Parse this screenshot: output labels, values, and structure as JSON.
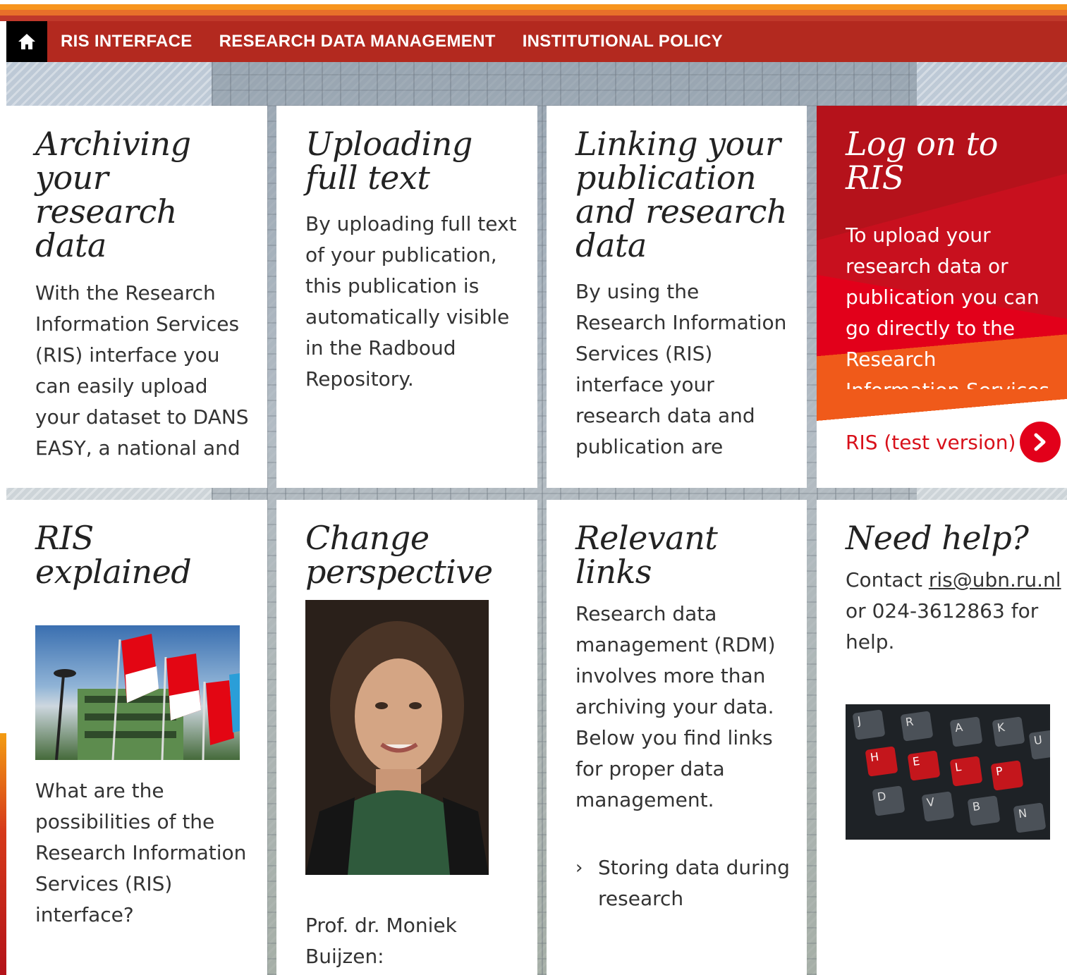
{
  "nav": {
    "home_label": "Home",
    "items": [
      {
        "label": "RIS INTERFACE"
      },
      {
        "label": "RESEARCH DATA MANAGEMENT"
      },
      {
        "label": "INSTITUTIONAL POLICY"
      }
    ]
  },
  "cards": {
    "archiving": {
      "title": "Archiving your research data",
      "body": "With the Research Information Services (RIS) interface you can easily upload your dataset to DANS EASY, a national and"
    },
    "uploading": {
      "title": "Uploading full text",
      "body": "By uploading full text of your publication, this publication is automatically visible in the Radboud Repository."
    },
    "linking": {
      "title": "Linking your publication and research data",
      "body": "By using the Research Information Services (RIS) interface your research data and publication are"
    },
    "login": {
      "title": "Log on to RIS",
      "body": "To upload your research data or publication you can go directly to the Research Information Services",
      "link_label": "RIS (test version)"
    },
    "ris_explained": {
      "title": "RIS explained",
      "image_alt": "Radboud University flags",
      "body": "What are the possibilities of the Research Information Services (RIS) interface?"
    },
    "change_perspective": {
      "title": "Change perspective",
      "image_alt": "Prof. dr. Moniek Buijzen portrait",
      "body": "Prof. dr. Moniek Buijzen:"
    },
    "relevant_links": {
      "title": "Relevant links",
      "body": "Research data management (RDM) involves more than archiving your data. Below you find links for proper data management.",
      "links": [
        {
          "label": "Storing data during research"
        }
      ]
    },
    "need_help": {
      "title": "Need help?",
      "contact_prefix": "Contact ",
      "email": "ris@ubn.ru.nl",
      "contact_suffix": " or",
      "phone_text": "024-3612863 for help.",
      "image_alt": "Keyboard with HELP keys"
    }
  },
  "keyboard_keys": [
    "J",
    "R",
    "A",
    "K",
    "U",
    "H",
    "E",
    "L",
    "P",
    "D",
    "V",
    "B",
    "N"
  ],
  "colors": {
    "nav_bg": "#b3291f",
    "home_bg": "#000000",
    "accent_red": "#e2001a",
    "link_red": "#d8101a"
  }
}
